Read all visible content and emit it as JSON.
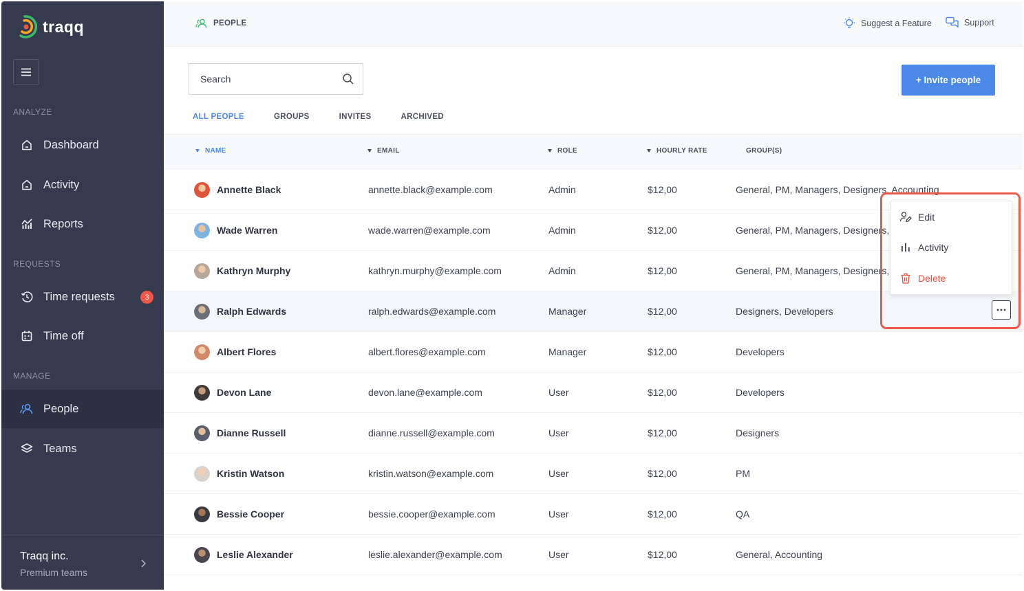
{
  "app": {
    "name": "traqq"
  },
  "sidebar": {
    "sections": [
      {
        "label": "ANALYZE"
      },
      {
        "label": "REQUESTS"
      },
      {
        "label": "MANAGE"
      }
    ],
    "items": [
      {
        "label": "Dashboard",
        "icon": "home-icon"
      },
      {
        "label": "Activity",
        "icon": "home-icon"
      },
      {
        "label": "Reports",
        "icon": "bar-chart-icon"
      },
      {
        "label": "Time requests",
        "icon": "clock-history-icon",
        "badge": "3"
      },
      {
        "label": "Time off",
        "icon": "calendar-icon"
      },
      {
        "label": "People",
        "icon": "people-icon",
        "active": true
      },
      {
        "label": "Teams",
        "icon": "layers-icon"
      }
    ],
    "org": {
      "name": "Traqq inc.",
      "plan": "Premium teams"
    }
  },
  "topbar": {
    "breadcrumb": "PEOPLE",
    "suggest": "Suggest a Feature",
    "support": "Support"
  },
  "search": {
    "placeholder": "Search"
  },
  "invite_label": "+ Invite people",
  "tabs": [
    "ALL PEOPLE",
    "GROUPS",
    "INVITES",
    "ARCHIVED"
  ],
  "columns": [
    "NAME",
    "EMAIL",
    "ROLE",
    "HOURLY RATE",
    "GROUP(S)"
  ],
  "rows": [
    {
      "name": "Annette Black",
      "email": "annette.black@example.com",
      "role": "Admin",
      "rate": "$12,00",
      "groups": "General, PM, Managers, Designers, Accounting"
    },
    {
      "name": "Wade Warren",
      "email": "wade.warren@example.com",
      "role": "Admin",
      "rate": "$12,00",
      "groups": "General, PM, Managers, Designers, A"
    },
    {
      "name": "Kathryn Murphy",
      "email": "kathryn.murphy@example.com",
      "role": "Admin",
      "rate": "$12,00",
      "groups": "General, PM, Managers, Designers, A"
    },
    {
      "name": "Ralph Edwards",
      "email": "ralph.edwards@example.com",
      "role": "Manager",
      "rate": "$12,00",
      "groups": "Designers, Developers"
    },
    {
      "name": "Albert Flores",
      "email": "albert.flores@example.com",
      "role": "Manager",
      "rate": "$12,00",
      "groups": "Developers"
    },
    {
      "name": "Devon Lane",
      "email": "devon.lane@example.com",
      "role": "User",
      "rate": "$12,00",
      "groups": "Developers"
    },
    {
      "name": "Dianne Russell",
      "email": "dianne.russell@example.com",
      "role": "User",
      "rate": "$12,00",
      "groups": "Designers"
    },
    {
      "name": "Kristin Watson",
      "email": "kristin.watson@example.com",
      "role": "User",
      "rate": "$12,00",
      "groups": "PM"
    },
    {
      "name": "Bessie Cooper",
      "email": "bessie.cooper@example.com",
      "role": "User",
      "rate": "$12,00",
      "groups": "QA"
    },
    {
      "name": "Leslie Alexander",
      "email": "leslie.alexander@example.com",
      "role": "User",
      "rate": "$12,00",
      "groups": "General, Accounting"
    }
  ],
  "row_menu": {
    "edit": "Edit",
    "activity": "Activity",
    "delete": "Delete"
  },
  "colors": {
    "sidebar": "#363a4f",
    "accent": "#4a89e6",
    "danger": "#e5503f",
    "highlight": "#ee5a4a"
  }
}
